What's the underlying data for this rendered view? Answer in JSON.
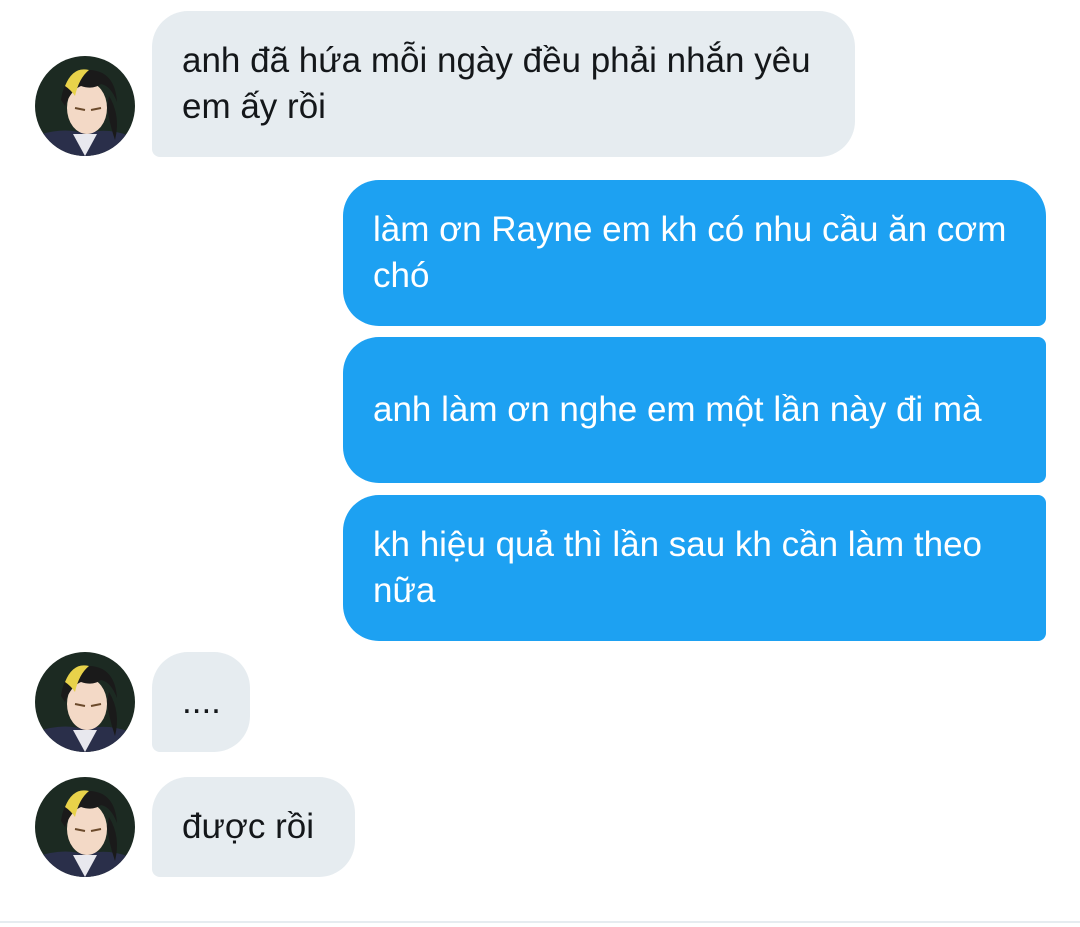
{
  "colors": {
    "incoming_bubble": "#e6ecf0",
    "outgoing_bubble": "#1da1f2",
    "incoming_text": "#14171a",
    "outgoing_text": "#ffffff"
  },
  "contact": {
    "avatar_icon": "anime-character-avatar-icon"
  },
  "messages": [
    {
      "direction": "in",
      "text": "anh đã hứa mỗi ngày đều phải nhắn yêu em ấy rồi"
    },
    {
      "direction": "out",
      "text": "làm ơn Rayne em kh có nhu cầu ăn cơm chó"
    },
    {
      "direction": "out",
      "text": "anh làm ơn nghe em một lần này đi mà"
    },
    {
      "direction": "out",
      "text": "kh hiệu quả thì lần sau kh cần làm theo nữa"
    },
    {
      "direction": "in",
      "text": "...."
    },
    {
      "direction": "in",
      "text": "được rồi"
    }
  ]
}
